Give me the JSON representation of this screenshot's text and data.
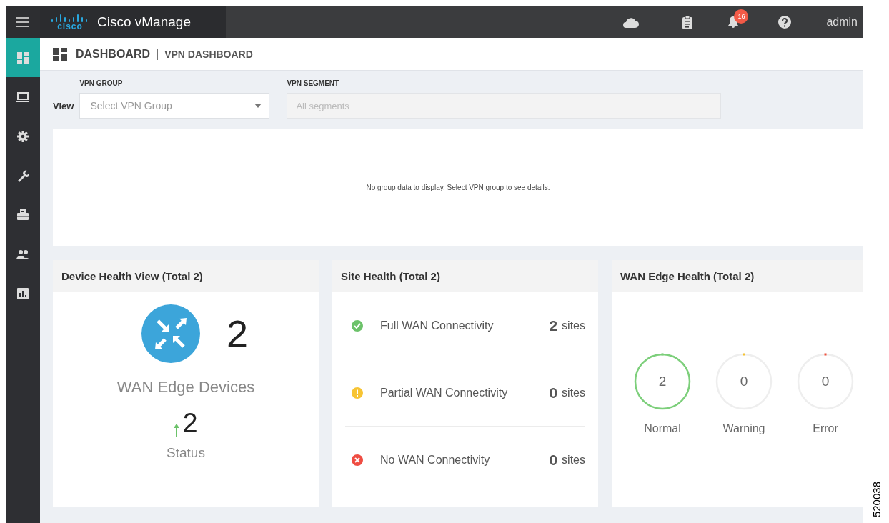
{
  "topbar": {
    "product": "Cisco vManage",
    "logo_text": "cisco",
    "notifications": "16",
    "user": "admin"
  },
  "sidebar": {
    "items": [
      {
        "selected": true
      },
      {
        "selected": false
      },
      {
        "selected": false
      },
      {
        "selected": false
      },
      {
        "selected": false
      },
      {
        "selected": false
      },
      {
        "selected": false
      }
    ]
  },
  "breadcrumb": {
    "title": "DASHBOARD",
    "separator": "|",
    "subtitle": "VPN DASHBOARD"
  },
  "filters": {
    "view_label": "View",
    "vpn_group": {
      "label": "VPN GROUP",
      "placeholder": "Select VPN Group"
    },
    "vpn_segment": {
      "label": "VPN SEGMENT",
      "placeholder": "All segments",
      "disabled": true
    }
  },
  "group_panel": {
    "message": "No group data to display. Select VPN group to see details."
  },
  "device_health": {
    "title": "Device Health View (Total 2)",
    "count": "2",
    "label": "WAN Edge Devices",
    "up_count": "2",
    "status_label": "Status"
  },
  "site_health": {
    "title": "Site Health (Total 2)",
    "rows": [
      {
        "kind": "ok",
        "label": "Full WAN Connectivity",
        "count": "2",
        "unit": "sites"
      },
      {
        "kind": "warning",
        "label": "Partial WAN Connectivity",
        "count": "0",
        "unit": "sites"
      },
      {
        "kind": "error",
        "label": "No WAN Connectivity",
        "count": "0",
        "unit": "sites"
      }
    ]
  },
  "wan_edge_health": {
    "title": "WAN Edge Health (Total 2)",
    "items": [
      {
        "value": "2",
        "label": "Normal",
        "color": "#7dcf7b"
      },
      {
        "value": "0",
        "label": "Warning",
        "color": "#f5c232"
      },
      {
        "value": "0",
        "label": "Error",
        "color": "#f0523f"
      }
    ]
  },
  "figure_number": "520038"
}
